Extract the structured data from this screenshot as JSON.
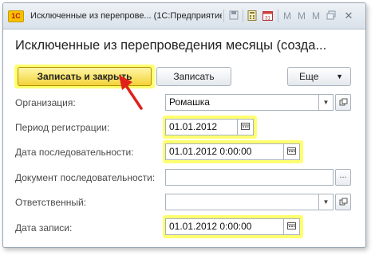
{
  "window": {
    "logo": "1С",
    "title": "Исключенные из перепрове... (1С:Предприятие)"
  },
  "titlebar_icons": [
    "save-icon",
    "calculator-icon",
    "calendar-icon",
    "memory-plus-icon",
    "memory-minus-icon",
    "restore-window-icon",
    "close-icon"
  ],
  "form": {
    "heading": "Исключенные из перепроведения месяцы (созда...",
    "save_close_label": "Записать и закрыть",
    "save_label": "Записать",
    "more_label": "Еще"
  },
  "fields": {
    "organization": {
      "label": "Организация:",
      "value": "Ромашка"
    },
    "period": {
      "label": "Период регистрации:",
      "value": "01.01.2012"
    },
    "sequence_date": {
      "label": "Дата последовательности:",
      "value": "01.01.2012  0:00:00"
    },
    "sequence_document": {
      "label": "Документ последовательности:",
      "value": ""
    },
    "responsible": {
      "label": "Ответственный:",
      "value": ""
    },
    "record_date": {
      "label": "Дата записи:",
      "value": "01.01.2012  0:00:00"
    }
  },
  "colors": {
    "highlight": "#ffff70",
    "primary_button": "#f3d33a",
    "arrow": "#e0201b"
  }
}
